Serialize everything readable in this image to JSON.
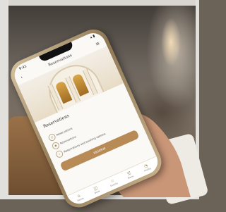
{
  "app": {
    "header_title": "Reservations",
    "status_time": "9:41",
    "status_icons": "▴ ▮",
    "panel_title": "Reservations",
    "panel_subtitle": "",
    "rows": [
      {
        "label": "Reservations",
        "icon": "calendar-icon",
        "glyph": "◷"
      },
      {
        "label": "Reservations",
        "icon": "user-icon",
        "glyph": "◉"
      },
      {
        "label": "Reservations and booking options",
        "icon": "info-icon",
        "glyph": "i"
      }
    ],
    "cta_label": "RESERVE",
    "tabs": [
      {
        "label": "Home",
        "glyph": "⌂"
      },
      {
        "label": "Book",
        "glyph": "◫"
      },
      {
        "label": "Events",
        "glyph": "☆"
      },
      {
        "label": "Menu",
        "glyph": "☰"
      },
      {
        "label": "Profile",
        "glyph": "◔"
      }
    ]
  },
  "colors": {
    "accent": "#b88a55",
    "screen_bg": "#fbf9f5"
  }
}
